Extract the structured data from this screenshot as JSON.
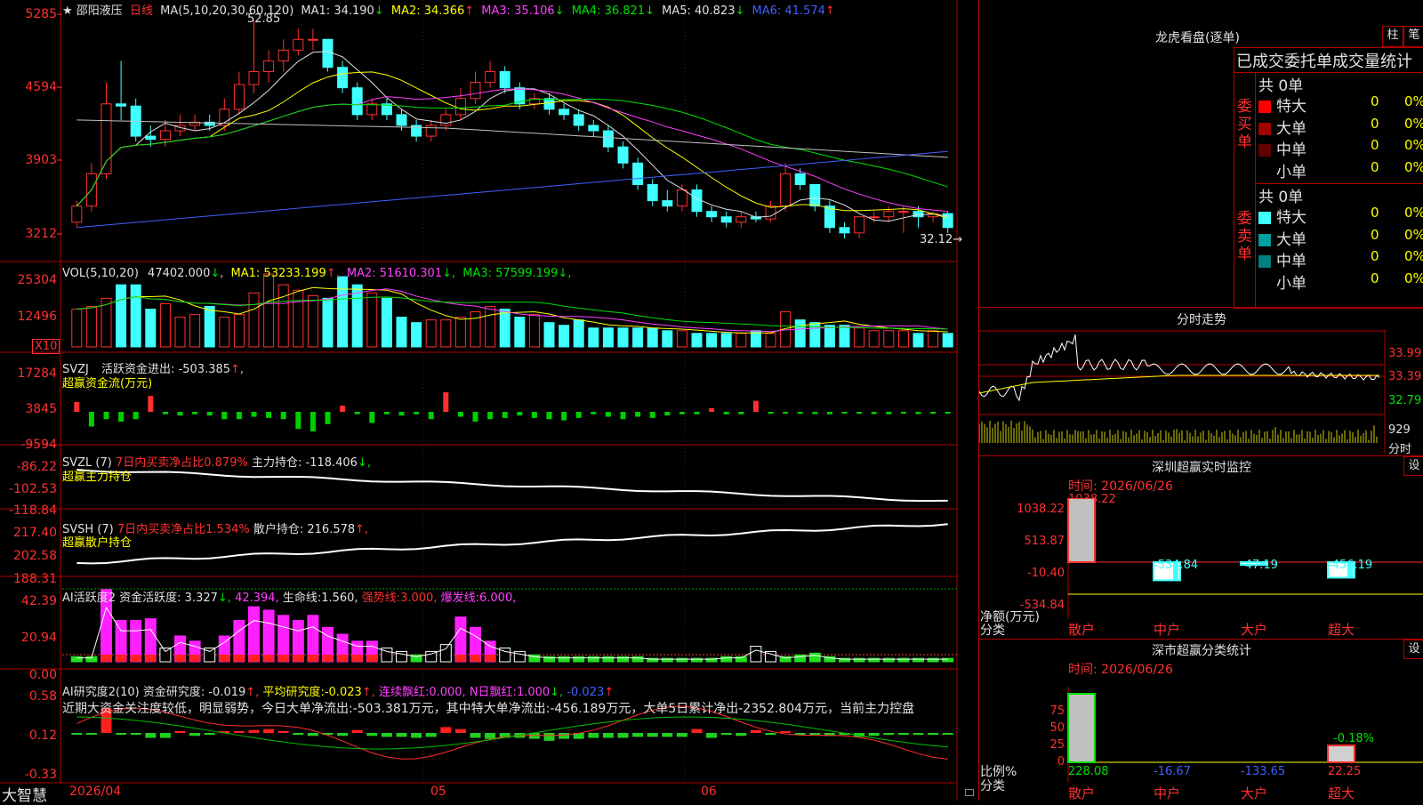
{
  "kline": {
    "star": "★",
    "stock_name": "邵阳液压",
    "period": "日线",
    "ma_title": "MA(5,10,20,30,60,120)",
    "ma": [
      {
        "label": "MA1:",
        "value": "34.190",
        "arrow": "↓",
        "color": "#e0e0e0"
      },
      {
        "label": "MA2:",
        "value": "34.366",
        "arrow": "↑",
        "color": "#ffff00"
      },
      {
        "label": "MA3:",
        "value": "35.106",
        "arrow": "↓",
        "color": "#ff40ff"
      },
      {
        "label": "MA4:",
        "value": "36.821",
        "arrow": "↓",
        "color": "#00e000"
      },
      {
        "label": "MA5:",
        "value": "40.823",
        "arrow": "↓",
        "color": "#e0e0e0"
      },
      {
        "label": "MA6:",
        "value": "41.574",
        "arrow": "↑",
        "color": "#4060ff"
      }
    ],
    "yaxis": [
      "5285",
      "4594",
      "3903",
      "3212"
    ],
    "high_label": "52.85",
    "low_label": "32.12→",
    "colors": {
      "up": "#ff3030",
      "down": "#40ffff"
    },
    "candles_open": [
      34.0,
      35.5,
      38.5,
      45.0,
      44.8,
      42.0,
      41.7,
      42.5,
      43.0,
      43.3,
      43.0,
      44.5,
      46.8,
      48.0,
      49.0,
      50.0,
      51.0,
      51.0,
      48.4,
      46.5,
      44.0,
      45.0,
      44.0,
      43.0,
      42.0,
      43.0,
      44.0,
      45.5,
      47.0,
      48.0,
      46.5,
      45.0,
      45.5,
      44.5,
      44.0,
      43.0,
      42.5,
      41.0,
      39.5,
      37.5,
      36.0,
      35.5,
      37.0,
      35.0,
      34.5,
      34.0,
      34.5,
      34.3,
      35.5,
      38.5,
      37.5,
      35.5,
      33.5,
      33.0,
      34.5,
      34.5,
      35.0,
      35.0,
      34.5,
      34.8
    ],
    "candles_close": [
      35.5,
      38.5,
      45.0,
      44.8,
      42.0,
      41.7,
      42.5,
      43.0,
      43.3,
      43.0,
      44.5,
      46.8,
      48.0,
      49.0,
      50.0,
      51.0,
      51.0,
      48.4,
      46.5,
      44.0,
      45.0,
      44.0,
      43.0,
      42.0,
      43.0,
      44.0,
      45.5,
      47.0,
      48.0,
      46.5,
      45.0,
      45.5,
      44.5,
      44.0,
      43.0,
      42.5,
      41.0,
      39.5,
      37.5,
      36.0,
      35.5,
      37.0,
      35.0,
      34.5,
      34.0,
      34.5,
      34.3,
      35.5,
      38.5,
      37.5,
      35.5,
      33.5,
      33.0,
      34.5,
      34.5,
      35.0,
      35.0,
      34.5,
      34.8,
      33.5
    ],
    "candles_high": [
      36.0,
      39.5,
      47.0,
      49.0,
      45.5,
      43.0,
      43.5,
      44.0,
      44.0,
      44.0,
      45.5,
      48.0,
      52.85,
      50.0,
      51.0,
      52.0,
      52.0,
      51.0,
      49.0,
      47.0,
      45.5,
      45.5,
      44.5,
      43.5,
      43.5,
      44.5,
      46.5,
      48.0,
      49.0,
      48.5,
      47.0,
      46.0,
      46.0,
      45.0,
      44.5,
      43.5,
      43.0,
      41.5,
      40.0,
      38.0,
      37.0,
      37.5,
      37.5,
      35.5,
      35.0,
      35.0,
      35.0,
      36.0,
      39.5,
      39.0,
      37.5,
      36.0,
      34.0,
      34.5,
      35.0,
      35.5,
      35.5,
      35.5,
      35.0,
      35.0
    ],
    "candles_low": [
      33.5,
      35.0,
      38.0,
      43.5,
      41.5,
      41.0,
      41.0,
      42.0,
      42.5,
      42.5,
      42.5,
      44.0,
      46.0,
      47.0,
      48.0,
      49.5,
      50.0,
      48.0,
      46.0,
      43.5,
      43.5,
      43.5,
      42.5,
      41.5,
      41.5,
      42.5,
      43.5,
      45.0,
      46.5,
      46.0,
      44.5,
      44.5,
      44.0,
      43.5,
      42.5,
      42.0,
      40.5,
      39.0,
      37.0,
      35.5,
      35.0,
      35.0,
      34.5,
      34.0,
      33.5,
      33.5,
      34.0,
      34.0,
      35.0,
      37.0,
      35.0,
      33.0,
      32.5,
      32.5,
      34.0,
      34.0,
      33.0,
      33.5,
      34.0,
      33.0
    ]
  },
  "vol": {
    "title": "VOL(5,10,20)",
    "value": "47402.000",
    "value_arrow": "↓",
    "ma": [
      {
        "label": "MA1:",
        "value": "53233.199",
        "arrow": "↑",
        "color": "#ffff00"
      },
      {
        "label": "MA2:",
        "value": "51610.301",
        "arrow": "↓",
        "color": "#ff40ff"
      },
      {
        "label": "MA3:",
        "value": "57599.199",
        "arrow": "↓",
        "color": "#00e000"
      }
    ],
    "yaxis": [
      "25304",
      "12496"
    ],
    "unit": "X10",
    "values": [
      14,
      15,
      18,
      23,
      23,
      14,
      16,
      11,
      12,
      15,
      11,
      12,
      20,
      27,
      23,
      21,
      19,
      18,
      26,
      23,
      20,
      18,
      11,
      9,
      10,
      10,
      11,
      13,
      15,
      14,
      11,
      12,
      9,
      8,
      10,
      7,
      7,
      7,
      7,
      7,
      6,
      6,
      5,
      5,
      5,
      5,
      6,
      5,
      13,
      10,
      9,
      8,
      8,
      7,
      6,
      6,
      6,
      5,
      6,
      5
    ]
  },
  "svzj": {
    "title": "SVZJ",
    "label": "活跃资金进出:",
    "value": "-503.385",
    "arrow": "↑",
    "subtitle": "超赢资金流(万元)",
    "yaxis": [
      "17284",
      "3845",
      "-9594"
    ],
    "values": [
      4000,
      -6000,
      -3000,
      -4000,
      -3000,
      6500,
      -1000,
      -1500,
      -1000,
      -1500,
      -3000,
      -3000,
      -2000,
      -2500,
      -3000,
      -7000,
      -8000,
      -5000,
      2500,
      -1000,
      -4500,
      -1000,
      -1500,
      -1000,
      -3000,
      8000,
      -2000,
      -4000,
      -3000,
      -2500,
      -1500,
      -2500,
      -3000,
      -3500,
      -2500,
      -1000,
      -2000,
      -3000,
      -2000,
      -2500,
      -1500,
      -1000,
      -1000,
      1500,
      -1000,
      -1000,
      4500,
      -800,
      -500,
      -800,
      -900,
      -1000,
      -500,
      -800,
      -900,
      -1000,
      -700,
      -900,
      -800,
      -500
    ]
  },
  "svzl": {
    "title": "SVZL (7)",
    "label1": "7日内买卖净占比0.879%",
    "label2": "主力持仓:",
    "value": "-118.406",
    "arrow": "↓,",
    "subtitle": "超赢主力持仓",
    "yaxis": [
      "-86.22",
      "-102.53",
      "-118.84"
    ]
  },
  "svsh": {
    "title": "SVSH (7)",
    "label1": "7日内买卖净占比1.534%",
    "label2": "散户持仓:",
    "value": "216.578",
    "arrow": "↑,",
    "subtitle": "超赢散户持仓",
    "yaxis": [
      "217.40",
      "202.58",
      "188.31"
    ]
  },
  "ai1": {
    "title": "AI活跃度2",
    "label": "资金活跃度:",
    "value": "3.327",
    "arrow": "↓,",
    "value2": "42.394,",
    "life_label": "生命线:",
    "life_value": "1.560,",
    "strong_label": "强势线:",
    "strong_value": "3.000,",
    "burst_label": "爆发线:",
    "burst_value": "6.000,",
    "yaxis": [
      "42.39",
      "20.94",
      "0.00"
    ],
    "values": [
      3,
      3,
      42,
      24,
      24,
      25,
      8,
      15,
      12,
      8,
      15,
      24,
      32,
      30,
      27,
      24,
      27,
      20,
      16,
      12,
      12,
      8,
      6,
      4,
      6,
      10,
      26,
      20,
      12,
      8,
      6,
      4,
      3,
      3,
      3,
      3,
      3,
      3,
      3,
      2,
      2,
      2,
      2,
      2,
      3,
      3,
      9,
      6,
      3,
      4,
      5,
      3,
      2,
      2,
      2,
      2,
      2,
      2,
      2,
      2
    ]
  },
  "ai2": {
    "title": "AI研究度2(10)",
    "label": "资金研究度:",
    "value": "-0.019",
    "arrow": "↑,",
    "avg_label": "平均研究度:",
    "avg_value": "-0.023",
    "avg_arrow": "↑,",
    "streak_label": "连续飘红:",
    "streak_value": "0.000,",
    "nday_label": "N日飘红:",
    "nday_value": "1.000",
    "nday_arrow": "↓,",
    "tail_value": "-0.023",
    "tail_arrow": "↑",
    "commentary": "近期大资金关注度较低，明显弱势，今日大单净流出:-503.381万元，其中特大单净流出:-456.189万元，大单5日累计净出-2352.804万元，当前主力控盘",
    "yaxis": [
      "0.58",
      "0.12",
      "-0.33"
    ],
    "values": [
      0,
      0,
      0.25,
      0,
      0,
      -0.05,
      -0.05,
      0.02,
      -0.03,
      -0.02,
      0.02,
      0.02,
      0.03,
      0.04,
      0.02,
      -0.02,
      -0.03,
      -0.02,
      -0.03,
      0.03,
      -0.03,
      -0.04,
      -0.04,
      -0.05,
      -0.04,
      0.06,
      0.04,
      -0.05,
      -0.06,
      -0.05,
      -0.05,
      -0.06,
      -0.08,
      -0.06,
      -0.06,
      -0.05,
      -0.05,
      -0.05,
      -0.04,
      -0.04,
      -0.04,
      -0.04,
      0.04,
      -0.05,
      -0.02,
      -0.03,
      0.03,
      -0.02,
      0.02,
      -0.02,
      -0.02,
      -0.03,
      -0.02,
      -0.04,
      -0.03,
      -0.02,
      -0.02,
      -0.02,
      -0.02,
      -0.01
    ]
  },
  "xaxis": {
    "labels": [
      "2026/04",
      "05",
      "06"
    ]
  },
  "brand": "大智慧",
  "right": {
    "lhb_title": "龙虎看盘(逐单)",
    "btn_col": "柱",
    "btn_pen": "笔",
    "stats_title": "已成交委托单成交量统计",
    "buy_vertical": "委买单",
    "sell_vertical": "委卖单",
    "buy_total": "共 0单",
    "sell_total": "共 0单",
    "buy_rows": [
      {
        "name": "特大",
        "count": "0",
        "pct": "0%",
        "color": "#ff0000"
      },
      {
        "name": "大单",
        "count": "0",
        "pct": "0%",
        "color": "#a00000"
      },
      {
        "name": "中单",
        "count": "0",
        "pct": "0%",
        "color": "#600000"
      },
      {
        "name": "小单",
        "count": "0",
        "pct": "0%",
        "color": ""
      }
    ],
    "sell_rows": [
      {
        "name": "特大",
        "count": "0",
        "pct": "0%",
        "color": "#40ffff"
      },
      {
        "name": "大单",
        "count": "0",
        "pct": "0%",
        "color": "#00a0a0"
      },
      {
        "name": "中单",
        "count": "0",
        "pct": "0%",
        "color": "#008080"
      },
      {
        "name": "小单",
        "count": "0",
        "pct": "0%",
        "color": ""
      }
    ],
    "intraday_title": "分时走势",
    "intraday_y": [
      "33.99",
      "33.39",
      "32.79"
    ],
    "intraday_vol": "929",
    "intraday_unit": "分时",
    "sz_title": "深圳超赢实时监控",
    "sz_time": "时间: 2026/06/26",
    "sz_y": [
      "1038.22",
      "513.87",
      "-10.40",
      "-534.84"
    ],
    "sz_top_label": "1038.22",
    "sz_bar_labels": [
      "-534.84",
      "-47.19",
      "-456.19"
    ],
    "sz_net_label": "净额(万元)",
    "sz_cat_label": "分类",
    "categories": [
      "散户",
      "中户",
      "大户",
      "超大"
    ],
    "sz_values": [
      1038.22,
      -534.84,
      -47.19,
      -456.19
    ],
    "sc_title": "深市超赢分类统计",
    "sc_time": "时间: 2026/06/26",
    "sc_y": [
      "75",
      "50",
      "25",
      "0"
    ],
    "sc_pct_label": "-0.18%",
    "sc_ratio_label": "比例%",
    "sc_cat_label": "分类",
    "sc_values": [
      "228.08",
      "-16.67",
      "-133.65",
      "22.25"
    ],
    "sc_value_colors": [
      "#00e000",
      "#4060ff",
      "#4060ff",
      "#ff3030"
    ],
    "btn_set": "设"
  }
}
